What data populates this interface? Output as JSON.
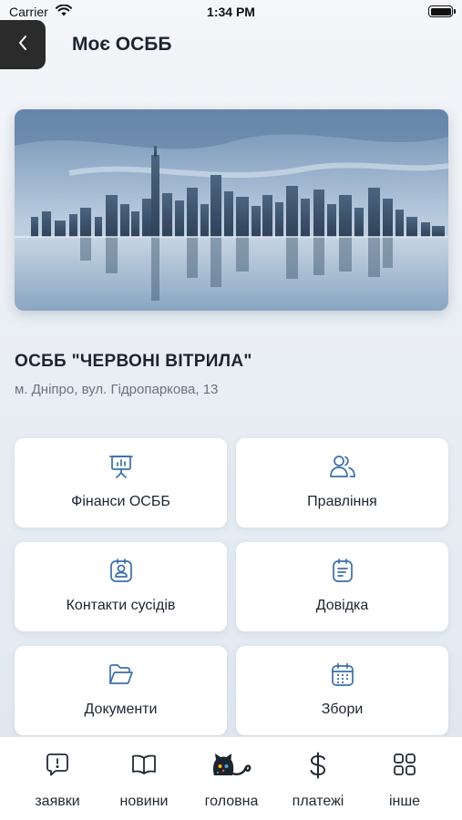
{
  "status_bar": {
    "carrier": "Carrier",
    "time": "1:34 PM"
  },
  "header": {
    "title": "Моє ОСББ",
    "back_icon": "chevron-left-icon"
  },
  "hero": {
    "image": "city-skyline-reflection"
  },
  "org": {
    "name": "ОСББ \"ЧЕРВОНІ ВІТРИЛА\"",
    "address": "м. Дніпро, вул. Гідропаркова, 13"
  },
  "tiles": [
    {
      "label": "Фінанси ОСББ",
      "icon": "presentation-chart-icon"
    },
    {
      "label": "Правління",
      "icon": "people-icon"
    },
    {
      "label": "Контакти сусідів",
      "icon": "contact-badge-icon"
    },
    {
      "label": "Довідка",
      "icon": "clipboard-icon"
    },
    {
      "label": "Документи",
      "icon": "folder-icon"
    },
    {
      "label": "Збори",
      "icon": "calendar-icon"
    }
  ],
  "tab_bar": [
    {
      "label": "заявки",
      "icon": "alert-message-icon"
    },
    {
      "label": "новини",
      "icon": "book-icon"
    },
    {
      "label": "головна",
      "icon": "cat-logo-icon"
    },
    {
      "label": "платежі",
      "icon": "dollar-icon"
    },
    {
      "label": "інше",
      "icon": "grid-icon"
    }
  ],
  "colors": {
    "accent": "#3b6ea8",
    "background": "#eef2f6",
    "tile_bg": "#ffffff",
    "back_button_bg": "#2b2b2b"
  }
}
